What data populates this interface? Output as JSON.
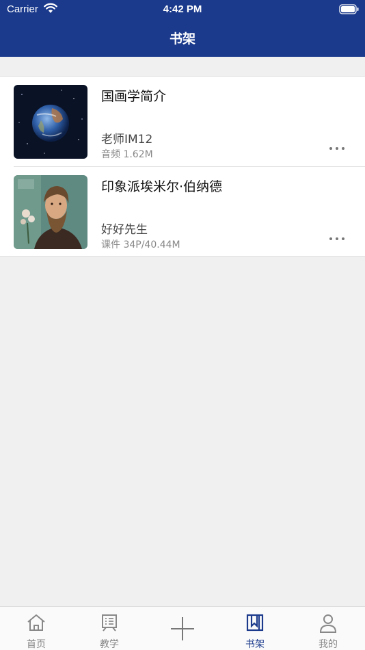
{
  "status_bar": {
    "carrier": "Carrier",
    "time": "4:42 PM"
  },
  "nav": {
    "title": "书架"
  },
  "items": [
    {
      "title": "国画学简介",
      "author": "老师IM12",
      "meta": "音频 1.62M",
      "thumb_icon": "earth-image"
    },
    {
      "title": "印象派埃米尔·伯纳德",
      "author": "好好先生",
      "meta": "课件 34P/40.44M",
      "thumb_icon": "portrait-image"
    }
  ],
  "tabs": [
    {
      "label": "首页",
      "icon": "home-icon"
    },
    {
      "label": "教学",
      "icon": "teaching-icon"
    },
    {
      "label": "",
      "icon": "plus-icon"
    },
    {
      "label": "书架",
      "icon": "bookshelf-icon",
      "active": true
    },
    {
      "label": "我的",
      "icon": "profile-icon"
    }
  ],
  "colors": {
    "nav_bg": "#1b3a8c",
    "active_tab": "#1b3a8c",
    "background": "#f0f0f0"
  }
}
